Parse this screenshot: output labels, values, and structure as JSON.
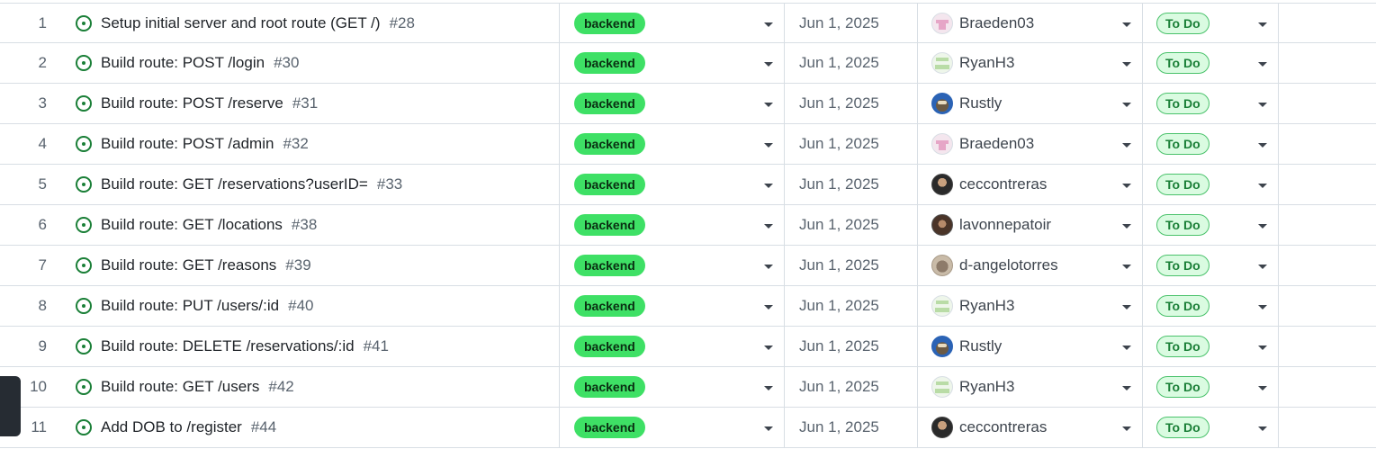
{
  "rows": [
    {
      "num": "1",
      "title": "Setup initial server and root route (GET /)",
      "issue": "#28",
      "label": "backend",
      "date": "Jun 1, 2025",
      "assignee": "Braeden03",
      "avatar": "identicon-pink",
      "status": "To Do"
    },
    {
      "num": "2",
      "title": "Build route: POST /login",
      "issue": "#30",
      "label": "backend",
      "date": "Jun 1, 2025",
      "assignee": "RyanH3",
      "avatar": "identicon-green",
      "status": "To Do"
    },
    {
      "num": "3",
      "title": "Build route: POST /reserve",
      "issue": "#31",
      "label": "backend",
      "date": "Jun 1, 2025",
      "assignee": "Rustly",
      "avatar": "photo-owl",
      "status": "To Do"
    },
    {
      "num": "4",
      "title": "Build route: POST /admin",
      "issue": "#32",
      "label": "backend",
      "date": "Jun 1, 2025",
      "assignee": "Braeden03",
      "avatar": "identicon-pink",
      "status": "To Do"
    },
    {
      "num": "5",
      "title": "Build route: GET /reservations?userID=",
      "issue": "#33",
      "label": "backend",
      "date": "Jun 1, 2025",
      "assignee": "ceccontreras",
      "avatar": "photo-person",
      "status": "To Do"
    },
    {
      "num": "6",
      "title": "Build route: GET /locations",
      "issue": "#38",
      "label": "backend",
      "date": "Jun 1, 2025",
      "assignee": "lavonnepatoir",
      "avatar": "photo-person2",
      "status": "To Do"
    },
    {
      "num": "7",
      "title": "Build route: GET /reasons",
      "issue": "#39",
      "label": "backend",
      "date": "Jun 1, 2025",
      "assignee": "d-angelotorres",
      "avatar": "photo-cat",
      "status": "To Do"
    },
    {
      "num": "8",
      "title": "Build route: PUT /users/:id",
      "issue": "#40",
      "label": "backend",
      "date": "Jun 1, 2025",
      "assignee": "RyanH3",
      "avatar": "identicon-green",
      "status": "To Do"
    },
    {
      "num": "9",
      "title": "Build route: DELETE /reservations/:id",
      "issue": "#41",
      "label": "backend",
      "date": "Jun 1, 2025",
      "assignee": "Rustly",
      "avatar": "photo-owl",
      "status": "To Do"
    },
    {
      "num": "10",
      "title": "Build route: GET /users",
      "issue": "#42",
      "label": "backend",
      "date": "Jun 1, 2025",
      "assignee": "RyanH3",
      "avatar": "identicon-green",
      "status": "To Do"
    },
    {
      "num": "11",
      "title": "Add DOB to /register",
      "issue": "#44",
      "label": "backend",
      "date": "Jun 1, 2025",
      "assignee": "ceccontreras",
      "avatar": "photo-person",
      "status": "To Do"
    }
  ],
  "colors": {
    "label_bg": "#3ee065",
    "status_bg": "#dafbe1",
    "status_fg": "#1a7f37",
    "open_issue_icon": "#1a7f37",
    "border": "#d8dee4"
  },
  "icons": {
    "issue": "issue-opened-icon",
    "dropdown": "triangle-down-icon"
  }
}
